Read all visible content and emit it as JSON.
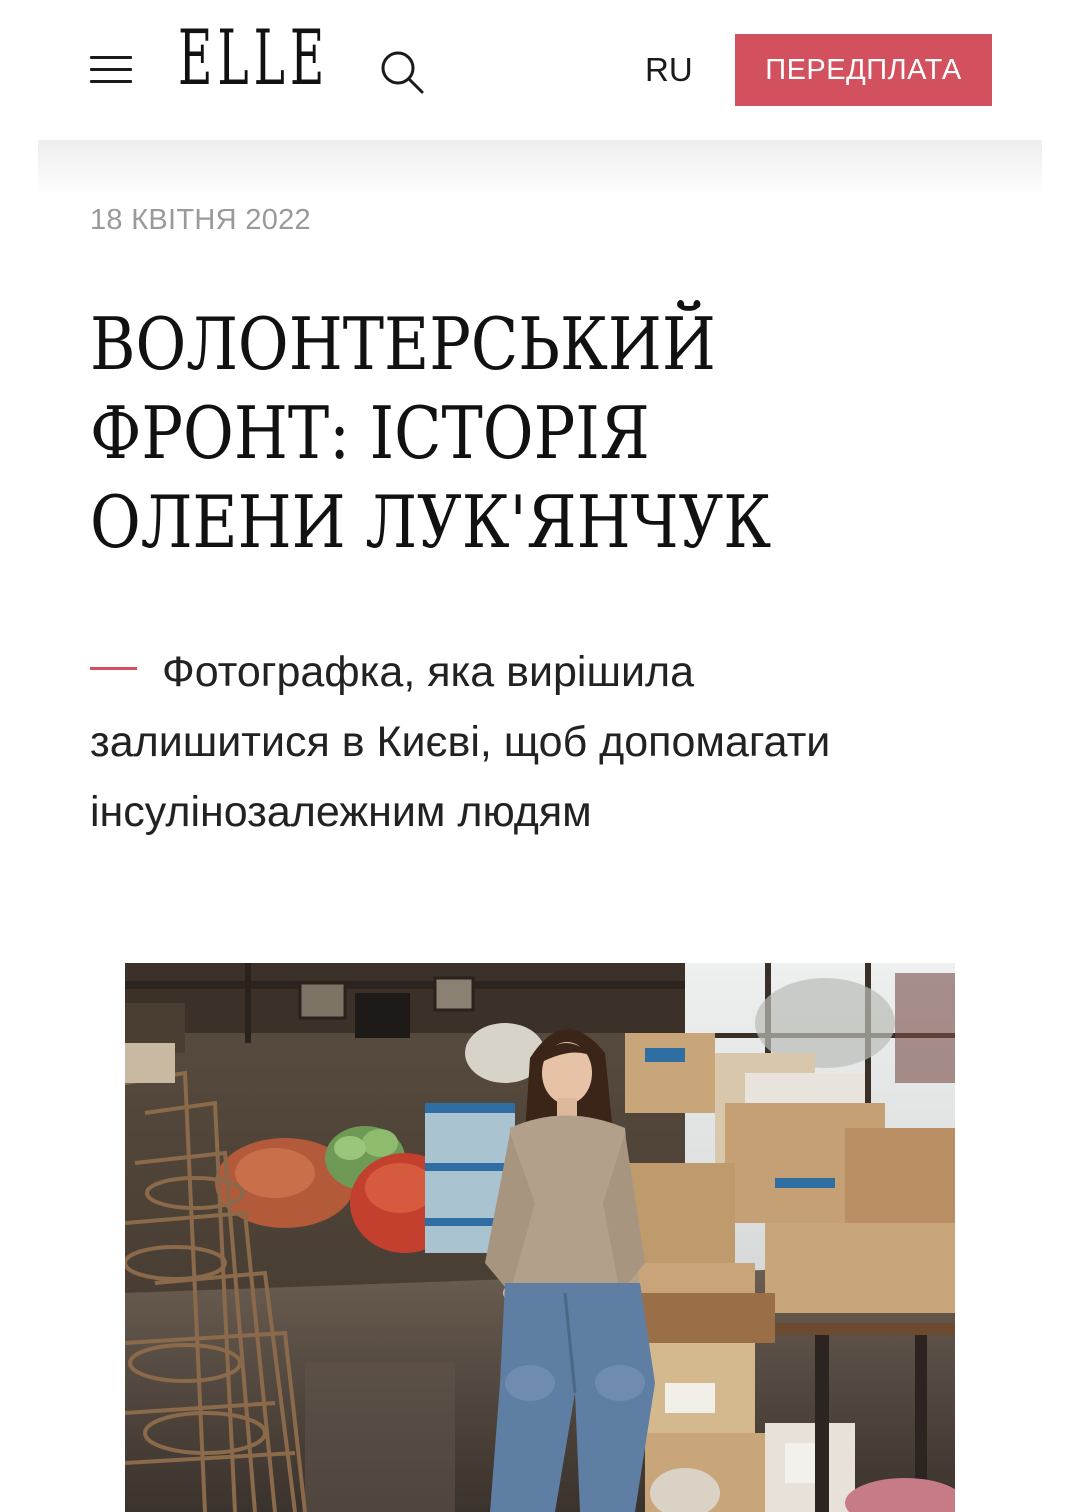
{
  "header": {
    "logo": "ELLE",
    "language": "RU",
    "subscribe_label": "ПЕРЕДПЛАТА",
    "menu_icon": "hamburger-menu-icon",
    "search_icon": "search-icon",
    "accent_color": "#d3505f"
  },
  "article": {
    "date": "18 КВІТНЯ 2022",
    "title_lines": [
      "ВОЛОНТЕРСЬКИЙ",
      "ФРОНТ: ІСТОРІЯ",
      "ОЛЕНИ ЛУК'ЯНЧУК"
    ],
    "lead": "Фотографка, яка вирішила залишитися в Києві, щоб допомагати інсулінозалежним людям"
  }
}
